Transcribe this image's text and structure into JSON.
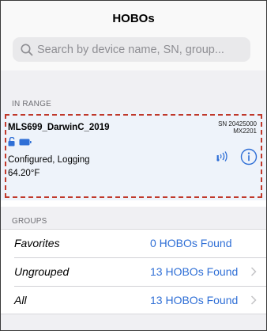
{
  "header": {
    "title": "HOBOs",
    "search_placeholder": "Search by device name, SN, group..."
  },
  "in_range": {
    "label": "IN RANGE",
    "device": {
      "name": "MLS699_DarwinC_2019",
      "sn_line1": "SN 20425000",
      "sn_line2": "MX2201",
      "status": "Configured, Logging",
      "temperature": "64.20°F"
    }
  },
  "groups": {
    "label": "GROUPS",
    "rows": [
      {
        "name": "Favorites",
        "count": "0 HOBOs Found",
        "chevron": false
      },
      {
        "name": "Ungrouped",
        "count": "13 HOBOs Found",
        "chevron": true
      },
      {
        "name": "All",
        "count": "13 HOBOs Found",
        "chevron": true
      }
    ]
  },
  "colors": {
    "accent": "#2f6fd6",
    "highlight_dash": "#c0392b",
    "card_background": "#eef3fa"
  },
  "icons": [
    "search-icon",
    "unlock-icon",
    "battery-icon",
    "signal-icon",
    "info-icon",
    "chevron-right-icon"
  ]
}
